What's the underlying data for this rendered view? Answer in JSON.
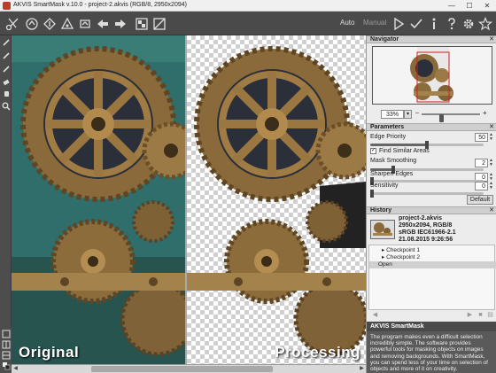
{
  "window": {
    "title": "AKVIS SmartMask v.10.0 - project-2.akvis (RGB/8, 2950x2094)",
    "minimize": "—",
    "maximize": "☐",
    "close": "✕"
  },
  "toolbar": {
    "mode_auto": "Auto",
    "mode_manual": "Manual"
  },
  "views": {
    "original_label": "Original",
    "processing_label": "Processing"
  },
  "navigator": {
    "title": "Navigator",
    "zoom": "33%",
    "zoom_level": 0.33
  },
  "parameters": {
    "title": "Parameters",
    "edge_priority_label": "Edge Priority",
    "edge_priority": "50",
    "find_similar_label": "Find Similar Areas",
    "find_similar_checked": "✓",
    "mask_smoothing_label": "Mask Smoothing",
    "mask_smoothing": "2",
    "sharpen_edges_label": "Sharpen Edges",
    "sharpen_edges": "0",
    "sensitivity_label": "Sensitivity",
    "sensitivity": "0",
    "default_button": "Default"
  },
  "history": {
    "title": "History",
    "file_name": "project-2.akvis",
    "dims": "2950x2094, RGB/8",
    "profile": "sRGB IEC61966-2.1",
    "date": "21.08.2015 9:26:56",
    "items": [
      {
        "label": "Checkpoint 1"
      },
      {
        "label": "Checkpoint 2"
      },
      {
        "label": "Open"
      }
    ]
  },
  "about": {
    "title": "AKVIS SmartMask",
    "text": "The program makes even a difficult selection incredibly simple. The software provides powerful tools for masking objects on images and removing backgrounds. With SmartMask, you can spend less of your time on selection of objects and more of it on creativity."
  }
}
